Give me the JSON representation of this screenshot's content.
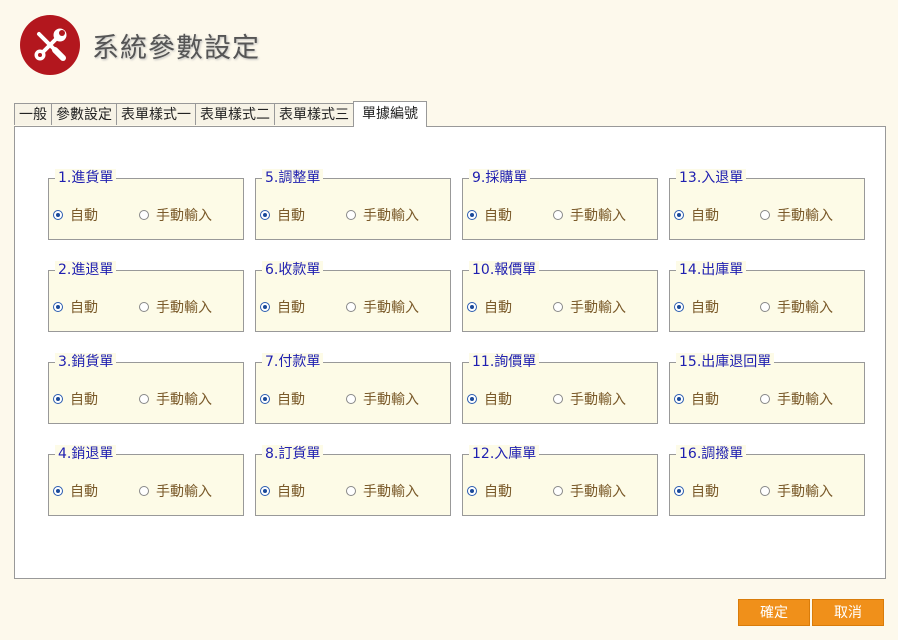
{
  "header": {
    "title": "系統參數設定",
    "icon": "tools-icon",
    "icon_color": "#b3171e"
  },
  "tabs": [
    {
      "label": "一般",
      "active": false
    },
    {
      "label": "參數設定",
      "active": false
    },
    {
      "label": "表單樣式一",
      "active": false
    },
    {
      "label": "表單樣式二",
      "active": false
    },
    {
      "label": "表單樣式三",
      "active": false
    },
    {
      "label": "單據編號",
      "active": true
    }
  ],
  "groups": [
    {
      "label": "1.進貨單",
      "auto": "自動",
      "manual": "手動輸入",
      "selected": "auto"
    },
    {
      "label": "5.調整單",
      "auto": "自動",
      "manual": "手動輸入",
      "selected": "auto"
    },
    {
      "label": "9.採購單",
      "auto": "自動",
      "manual": "手動輸入",
      "selected": "auto"
    },
    {
      "label": "13.入退單",
      "auto": "自動",
      "manual": "手動輸入",
      "selected": "auto"
    },
    {
      "label": "2.進退單",
      "auto": "自動",
      "manual": "手動輸入",
      "selected": "auto"
    },
    {
      "label": "6.收款單",
      "auto": "自動",
      "manual": "手動輸入",
      "selected": "auto"
    },
    {
      "label": "10.報價單",
      "auto": "自動",
      "manual": "手動輸入",
      "selected": "auto"
    },
    {
      "label": "14.出庫單",
      "auto": "自動",
      "manual": "手動輸入",
      "selected": "auto"
    },
    {
      "label": "3.銷貨單",
      "auto": "自動",
      "manual": "手動輸入",
      "selected": "auto"
    },
    {
      "label": "7.付款單",
      "auto": "自動",
      "manual": "手動輸入",
      "selected": "auto"
    },
    {
      "label": "11.詢價單",
      "auto": "自動",
      "manual": "手動輸入",
      "selected": "auto"
    },
    {
      "label": "15.出庫退回單",
      "auto": "自動",
      "manual": "手動輸入",
      "selected": "auto"
    },
    {
      "label": "4.銷退單",
      "auto": "自動",
      "manual": "手動輸入",
      "selected": "auto"
    },
    {
      "label": "8.訂貨單",
      "auto": "自動",
      "manual": "手動輸入",
      "selected": "auto"
    },
    {
      "label": "12.入庫單",
      "auto": "自動",
      "manual": "手動輸入",
      "selected": "auto"
    },
    {
      "label": "16.調撥單",
      "auto": "自動",
      "manual": "手動輸入",
      "selected": "auto"
    }
  ],
  "buttons": {
    "confirm": "確定",
    "cancel": "取消",
    "color": "#f0901a"
  }
}
